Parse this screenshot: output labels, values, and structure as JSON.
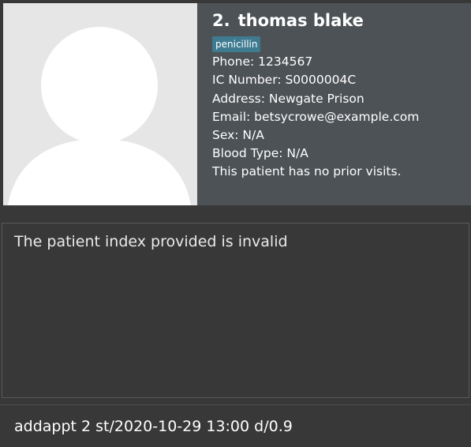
{
  "patient": {
    "index": "2.",
    "name": "thomas blake",
    "tags": [
      "penicillin"
    ],
    "phone": "Phone: 1234567",
    "ic_number": "IC Number: S0000004C",
    "address": "Address: Newgate Prison",
    "email": "Email: betsycrowe@example.com",
    "sex": "Sex: N/A",
    "blood_type": "Blood Type: N/A",
    "visits": "This patient has no prior visits."
  },
  "result": {
    "message": "The patient index provided is invalid"
  },
  "command": {
    "value": "addappt 2 st/2020-10-29 13:00 d/0.9"
  },
  "colors": {
    "background": "#383838",
    "card_details": "#4d5256",
    "tag": "#3e7b91",
    "avatar_silhouette": "#e6e6e6"
  },
  "icons": {
    "avatar": "default-person-silhouette"
  }
}
